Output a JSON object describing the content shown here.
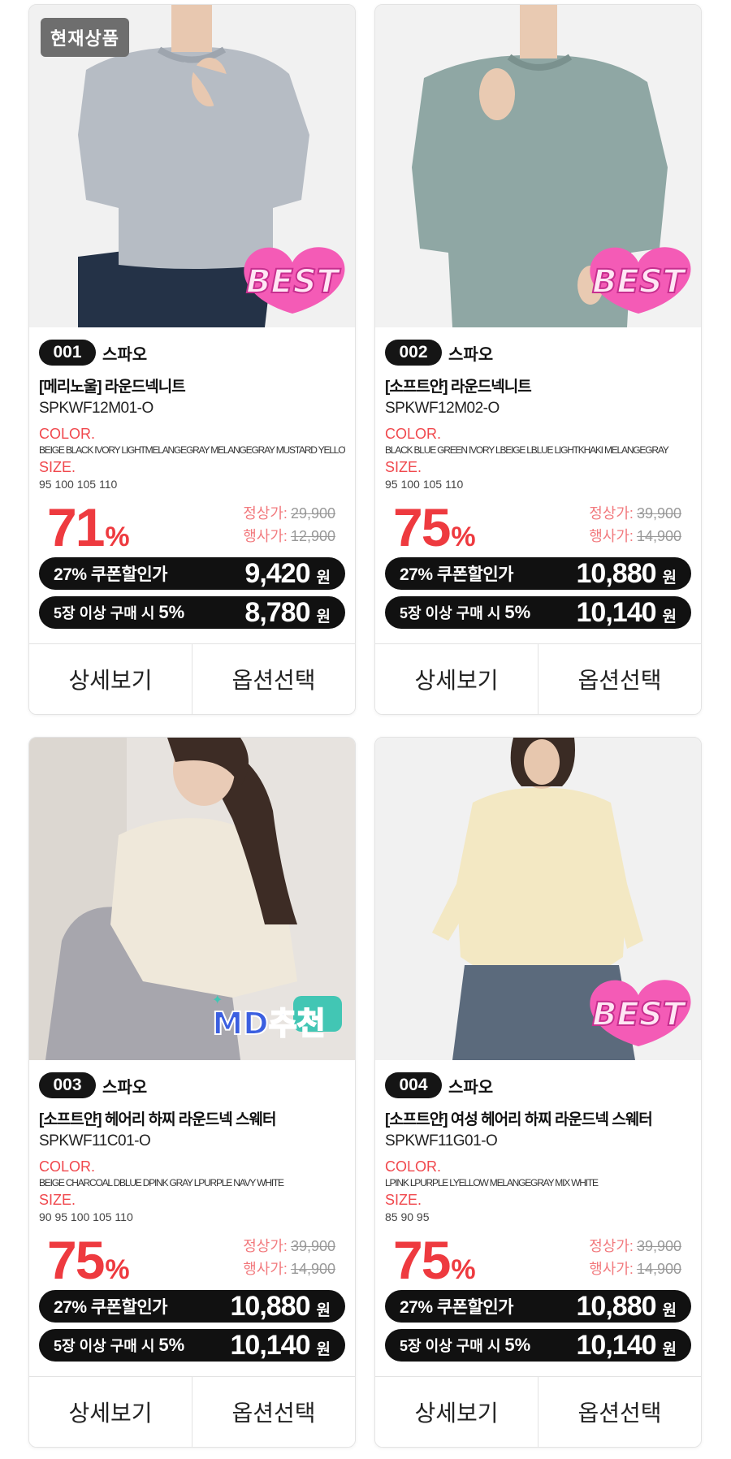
{
  "badge_current": "현재상품",
  "labels": {
    "color": "COLOR.",
    "size": "SIZE.",
    "regular_price": "정상가:",
    "event_price": "행사가:",
    "coupon_text": "27% 쿠폰할인가",
    "bulk_text_prefix": "5장 이상 구매 시 ",
    "bulk_text_pct": "5%",
    "won": "원",
    "percent": "%",
    "detail_button": "상세보기",
    "option_button": "옵션선택"
  },
  "products": [
    {
      "number": "001",
      "brand": "스파오",
      "name": "[메리노울] 라운드넥니트",
      "code": "SPKWF12M01-O",
      "colors": "BEIGE BLACK IVORY LIGHTMELANGEGRAY MELANGEGRAY MUSTARD YELLOW",
      "sizes": "95 100 105 110",
      "discount": "71",
      "regular_price": "29,900",
      "event_price": "12,900",
      "coupon_price": "9,420",
      "bulk_price": "8,780",
      "sticker": "BEST",
      "sweater_color": "#b6bcc4"
    },
    {
      "number": "002",
      "brand": "스파오",
      "name": "[소프트얀] 라운드넥니트",
      "code": "SPKWF12M02-O",
      "colors": "BLACK BLUE GREEN IVORY LBEIGE LBLUE LIGHTKHAKI MELANGEGRAY",
      "sizes": "95 100 105 110",
      "discount": "75",
      "regular_price": "39,900",
      "event_price": "14,900",
      "coupon_price": "10,880",
      "bulk_price": "10,140",
      "sticker": "BEST",
      "sweater_color": "#8fa7a4"
    },
    {
      "number": "003",
      "brand": "스파오",
      "name": "[소프트얀] 헤어리 하찌 라운드넥 스웨터",
      "code": "SPKWF11C01-O",
      "colors": "BEIGE CHARCOAL DBLUE DPINK GRAY LPURPLE NAVY WHITE",
      "sizes": "90 95 100 105 110",
      "discount": "75",
      "regular_price": "39,900",
      "event_price": "14,900",
      "coupon_price": "10,880",
      "bulk_price": "10,140",
      "sticker": "MD추천",
      "sweater_color": "#efe8da"
    },
    {
      "number": "004",
      "brand": "스파오",
      "name": "[소프트얀] 여성 헤어리 하찌 라운드넥 스웨터",
      "code": "SPKWF11G01-O",
      "colors": "LPINK LPURPLE LYELLOW MELANGEGRAY MIX WHITE",
      "sizes": "85 90 95",
      "discount": "75",
      "regular_price": "39,900",
      "event_price": "14,900",
      "coupon_price": "10,880",
      "bulk_price": "10,140",
      "sticker": "BEST",
      "sweater_color": "#f3e8c3"
    }
  ],
  "colors": {
    "accent_red": "#ee3a3f",
    "pill_black": "#111111",
    "best_pink": "#f45bb6",
    "md_blue": "#3b5fe0"
  }
}
